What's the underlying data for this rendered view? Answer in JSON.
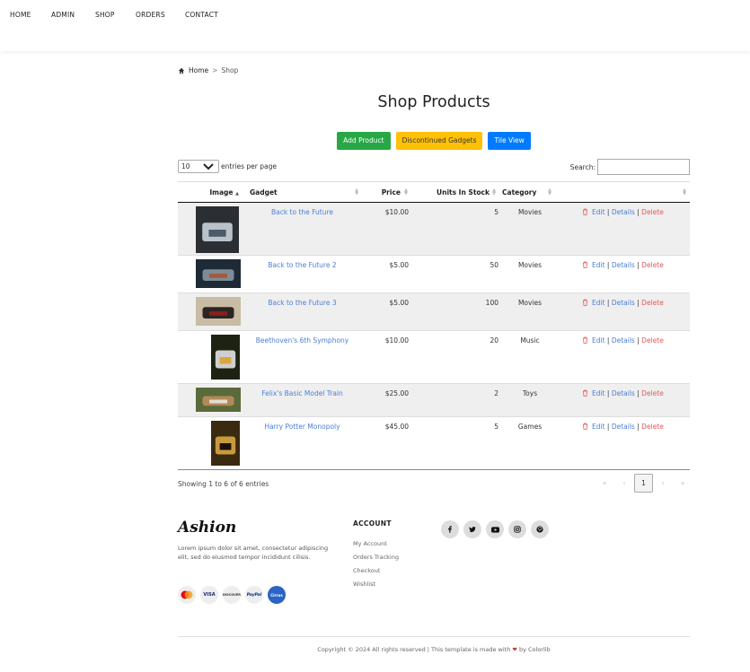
{
  "nav": [
    "HOME",
    "ADMIN",
    "SHOP",
    "ORDERS",
    "CONTACT"
  ],
  "breadcrumb": {
    "home": "Home",
    "sep": ">",
    "current": "Shop"
  },
  "page_title": "Shop Products",
  "buttons": {
    "add": "Add Product",
    "discontinued": "Discontinued Gadgets",
    "tile": "Tile View"
  },
  "table_controls": {
    "entries_value": "10",
    "entries_label": "entries per page",
    "search_label": "Search:"
  },
  "columns": [
    "Image",
    "Gadget",
    "Price",
    "Units In Stock",
    "Category",
    ""
  ],
  "rows": [
    {
      "gadget": "Back to the Future",
      "price": "$10.00",
      "units": "5",
      "category": "Movies"
    },
    {
      "gadget": "Back to the Future 2",
      "price": "$5.00",
      "units": "50",
      "category": "Movies"
    },
    {
      "gadget": "Back to the Future 3",
      "price": "$5.00",
      "units": "100",
      "category": "Movies"
    },
    {
      "gadget": "Beethoven's 6th Symphony",
      "price": "$10.00",
      "units": "20",
      "category": "Music"
    },
    {
      "gadget": "Felix's Basic Model Train",
      "price": "$25.00",
      "units": "2",
      "category": "Toys"
    },
    {
      "gadget": "Harry Potter Monopoly",
      "price": "$45.00",
      "units": "5",
      "category": "Games"
    }
  ],
  "actions": {
    "edit": "Edit",
    "details": "Details",
    "delete": "Delete",
    "sep": "|"
  },
  "table_info": "Showing 1 to 6 of 6 entries",
  "pagination": {
    "first": "«",
    "prev": "‹",
    "page": "1",
    "next": "›",
    "last": "»"
  },
  "footer": {
    "logo": "Ashion",
    "about": "Lorem ipsum dolor sit amet, consectetur adipiscing elit, sed do eiusmod tempor incididunt cilisis.",
    "cards": [
      "mastercard",
      "VISA",
      "DISCOVER",
      "PayPal",
      "Cirrus"
    ],
    "account_heading": "ACCOUNT",
    "account_links": [
      "My Account",
      "Orders Tracking",
      "Checkout",
      "Wishlist"
    ],
    "social": [
      "facebook-icon",
      "twitter-icon",
      "youtube-icon",
      "instagram-icon",
      "pinterest-icon"
    ],
    "copyright_pre": "Copyright © 2024 All rights reserved | This template is made with",
    "copyright_post": "by Colorlib"
  },
  "colors": {
    "green": "#28a745",
    "yellow": "#ffc107",
    "blue": "#007bff",
    "link": "#4a7fd8",
    "delete": "#e05a5a"
  }
}
